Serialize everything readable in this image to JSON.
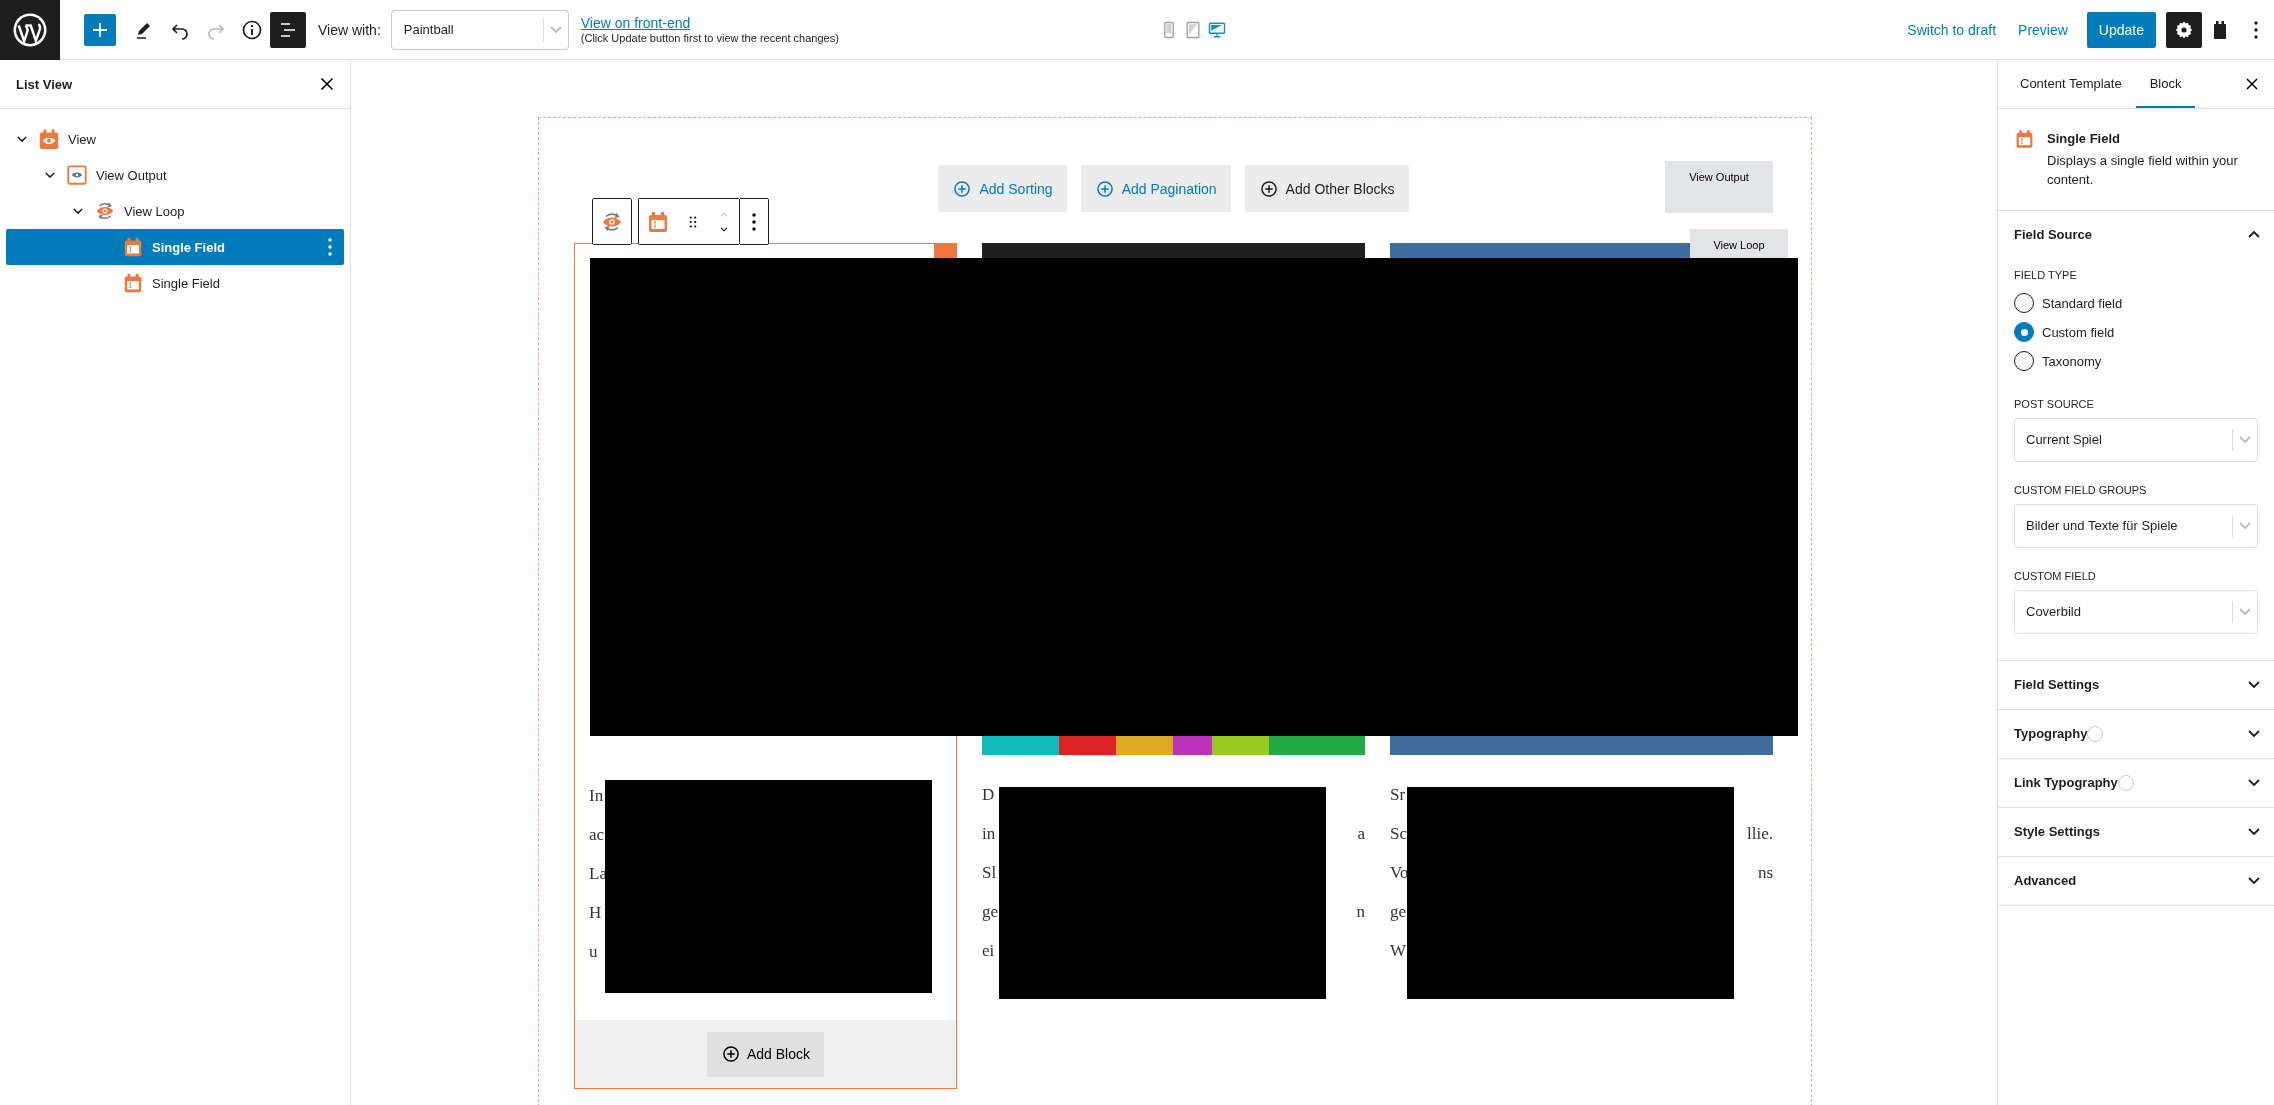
{
  "topbar": {
    "view_with_label": "View with:",
    "view_with_value": "Paintball",
    "front_end_link": "View on front-end",
    "front_end_note": "(Click Update button first to view the recent changes)",
    "list_view_open": true,
    "settings_open": true,
    "devices": [
      {
        "kind": "mobile",
        "selected": false
      },
      {
        "kind": "tablet",
        "selected": false
      },
      {
        "kind": "desktop",
        "selected": true
      }
    ],
    "switch_to_draft": "Switch to draft",
    "preview": "Preview",
    "update": "Update"
  },
  "list_view": {
    "title": "List View",
    "items": [
      {
        "label": "View",
        "expanded": true,
        "selected": false,
        "children": [
          {
            "label": "View Output",
            "expanded": true,
            "selected": false,
            "children": [
              {
                "label": "View Loop",
                "expanded": true,
                "selected": false,
                "children": [
                  {
                    "label": "Single Field",
                    "selected": true
                  },
                  {
                    "label": "Single Field",
                    "selected": false
                  }
                ]
              }
            ]
          }
        ]
      }
    ]
  },
  "canvas": {
    "buttons": [
      {
        "label": "Add Sorting",
        "kind": "accent"
      },
      {
        "label": "Add Pagination",
        "kind": "accent"
      },
      {
        "label": "Add Other Blocks",
        "kind": "plain"
      }
    ],
    "output_label": "View Output",
    "loop_label": "View Loop",
    "columns": [
      {
        "selected": true,
        "lines": [
          {
            "left": "In"
          },
          {
            "left": "ac"
          },
          {
            "left": "La"
          },
          {
            "left": "H"
          },
          {
            "left": "u"
          }
        ]
      },
      {
        "selected": false,
        "lines": [
          {
            "left": "D"
          },
          {
            "left": "in",
            "right": "a"
          },
          {
            "left": "Sl"
          },
          {
            "left": "ge",
            "right": "n"
          },
          {
            "left": "ei"
          }
        ]
      },
      {
        "selected": false,
        "lines": [
          {
            "left": "Sr"
          },
          {
            "left": "Sc",
            "right": "llie."
          },
          {
            "left": "Vo",
            "right": "ns"
          },
          {
            "left": "ge"
          },
          {
            "left": "W"
          }
        ]
      }
    ],
    "add_block": "Add Block"
  },
  "sidebar": {
    "tabs": [
      {
        "label": "Content Template",
        "selected": false
      },
      {
        "label": "Block",
        "selected": true
      }
    ],
    "block_title": "Single Field",
    "block_description": "Displays a single field within your content.",
    "panels": [
      {
        "title": "Field Source",
        "expanded": true,
        "field_type_label": "FIELD TYPE",
        "options": [
          {
            "label": "Standard field",
            "selected": false
          },
          {
            "label": "Custom field",
            "selected": true
          },
          {
            "label": "Taxonomy",
            "selected": false
          }
        ],
        "selects": [
          {
            "label": "POST SOURCE",
            "value": "Current Spiel"
          },
          {
            "label": "CUSTOM FIELD GROUPS",
            "value": "Bilder und Texte für Spiele"
          },
          {
            "label": "CUSTOM FIELD",
            "value": "Coverbild"
          }
        ]
      },
      {
        "title": "Field Settings",
        "expanded": false
      },
      {
        "title": "Typography",
        "expanded": false,
        "indicator": true
      },
      {
        "title": "Link Typography",
        "expanded": false,
        "indicator": true
      },
      {
        "title": "Style Settings",
        "expanded": false
      },
      {
        "title": "Advanced",
        "expanded": false
      }
    ]
  }
}
